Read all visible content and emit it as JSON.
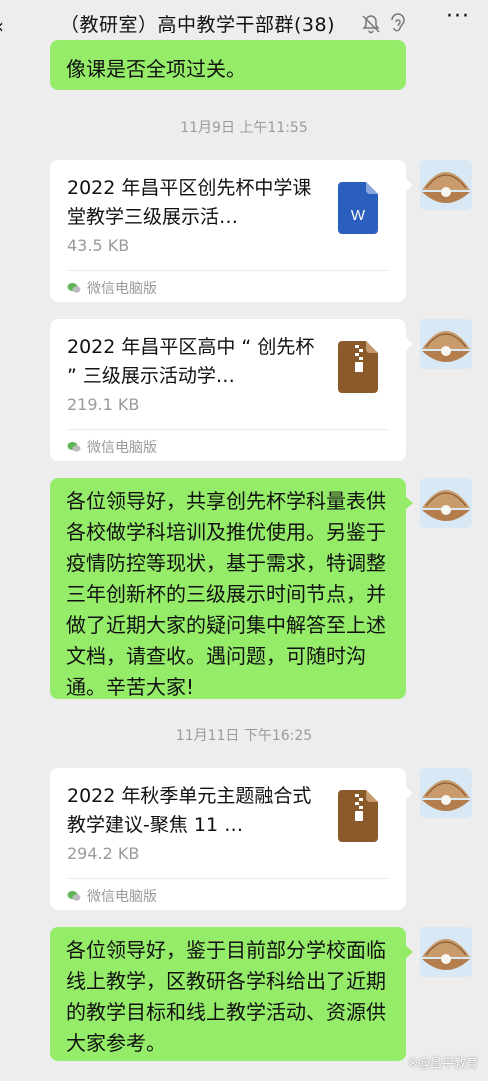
{
  "header": {
    "title": "（教研室）高中教学干部群(38)",
    "more_label": "···"
  },
  "messages": {
    "m0_text": "像课是否全项过关。",
    "ts1": "11月9日 上午11:55",
    "file1": {
      "name": "2022 年昌平区创先杯中学课堂教学三级展示活…",
      "size": "43.5 KB",
      "source": "微信电脑版",
      "type": "word-icon"
    },
    "file2": {
      "name": "2022 年昌平区高中 “ 创先杯 ” 三级展示活动学…",
      "size": "219.1 KB",
      "source": "微信电脑版",
      "type": "zip-icon"
    },
    "m3_text": "各位领导好，共享创先杯学科量表供各校做学科培训及推优使用。另鉴于疫情防控等现状，基于需求，特调整三年创新杯的三级展示时间节点，并做了近期大家的疑问集中解答至上述文档，请查收。遇问题，可随时沟通。辛苦大家!",
    "ts2": "11月11日 下午16:25",
    "file3": {
      "name": "2022 年秋季单元主题融合式教学建议-聚焦 11 …",
      "size": "294.2 KB",
      "source": "微信电脑版",
      "type": "zip-icon"
    },
    "m5_text": "各位领导好，鉴于目前部分学校面临线上教学，区教研各学科给出了近期的教学目标和线上教学活动、资源供大家参考。"
  },
  "watermark": "※@昌平教育",
  "colors": {
    "bubble": "#95ec69",
    "bg": "#ededed",
    "word": "#2b5fbd",
    "zip": "#8b5a2b"
  }
}
